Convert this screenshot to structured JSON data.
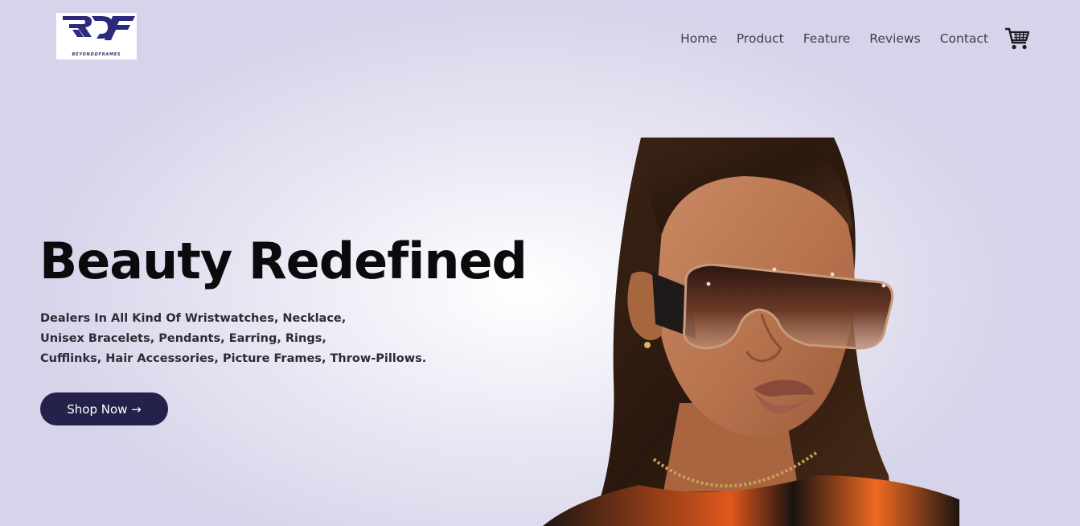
{
  "brand": {
    "logo_text": "BEYONDDFRAMES",
    "logo_color": "#2c2a7a"
  },
  "nav": {
    "items": [
      "Home",
      "Product",
      "Feature",
      "Reviews",
      "Contact"
    ],
    "cart_icon": "shopping-cart-icon"
  },
  "hero": {
    "title": "Beauty Redefined",
    "subtitle_lines": [
      "Dealers In All Kind Of Wristwatches, Necklace,",
      "Unisex Bracelets, Pendants, Earring, Rings,",
      "Cufflinks, Hair Accessories, Picture Frames, Throw-Pillows."
    ],
    "cta_label": "Shop Now →",
    "cta_color": "#24224a",
    "image": "model-with-sunglasses"
  },
  "colors": {
    "background": "#dddbf0",
    "title": "#0b0b0e",
    "nav_text": "#3f3f44"
  }
}
